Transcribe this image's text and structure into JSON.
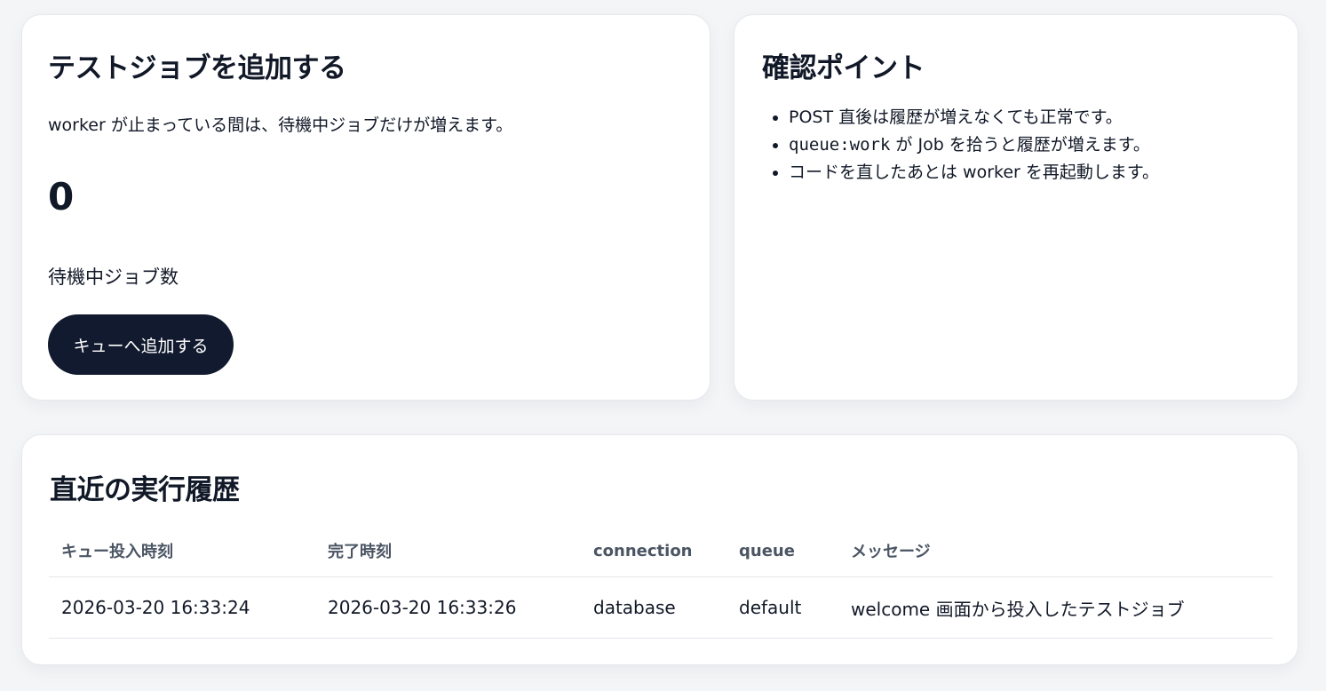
{
  "add_card": {
    "title": "テストジョブを追加する",
    "description": "worker が止まっている間は、待機中ジョブだけが増えます。",
    "pending_count": "0",
    "pending_label": "待機中ジョブ数",
    "button_label": "キューへ追加する"
  },
  "points_card": {
    "title": "確認ポイント",
    "items": [
      {
        "text": "POST 直後は履歴が増えなくても正常です。"
      },
      {
        "code": "queue:work",
        "text": " が Job を拾うと履歴が増えます。"
      },
      {
        "text": "コードを直したあとは worker を再起動します。"
      }
    ]
  },
  "history_card": {
    "title": "直近の実行履歴",
    "columns": [
      "キュー投入時刻",
      "完了時刻",
      "connection",
      "queue",
      "メッセージ"
    ],
    "rows": [
      [
        "2026-03-20 16:33:24",
        "2026-03-20 16:33:26",
        "database",
        "default",
        "welcome 画面から投入したテストジョブ"
      ]
    ]
  },
  "colors": {
    "background": "#f4f5f7",
    "card": "#ffffff",
    "text": "#111827",
    "header_text": "#4b5563",
    "button": "#111a2e",
    "button_text": "#ffffff",
    "divider": "#e5e7eb"
  }
}
